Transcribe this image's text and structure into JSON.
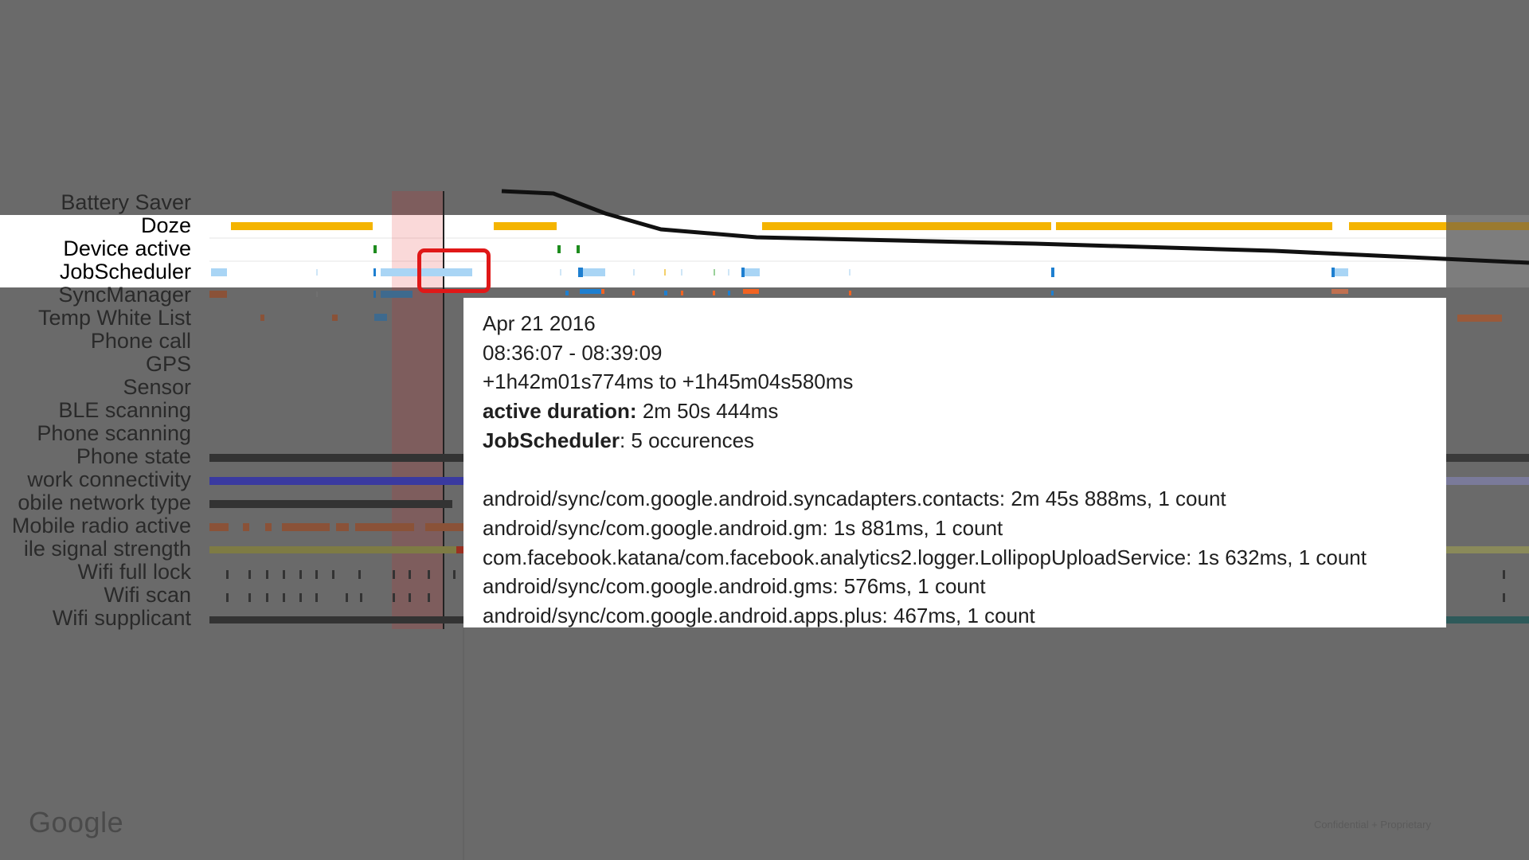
{
  "rows": [
    {
      "label": "Battery Saver",
      "highlighted": false
    },
    {
      "label": "Doze",
      "highlighted": true
    },
    {
      "label": "Device active",
      "highlighted": true
    },
    {
      "label": "JobScheduler",
      "highlighted": true
    },
    {
      "label": "SyncManager",
      "highlighted": false
    },
    {
      "label": "Temp White List",
      "highlighted": false
    },
    {
      "label": "Phone call",
      "highlighted": false
    },
    {
      "label": "GPS",
      "highlighted": false
    },
    {
      "label": "Sensor",
      "highlighted": false
    },
    {
      "label": "BLE scanning",
      "highlighted": false
    },
    {
      "label": "Phone scanning",
      "highlighted": false
    },
    {
      "label": "Phone state",
      "highlighted": false
    },
    {
      "label": "work connectivity",
      "highlighted": false
    },
    {
      "label": "obile network type",
      "highlighted": false
    },
    {
      "label": "Mobile radio active",
      "highlighted": false
    },
    {
      "label": "ile signal strength",
      "highlighted": false
    },
    {
      "label": "Wifi full lock",
      "highlighted": false
    },
    {
      "label": "Wifi scan",
      "highlighted": false
    },
    {
      "label": "Wifi supplicant",
      "highlighted": false
    }
  ],
  "tooltip": {
    "date": "Apr 21 2016",
    "time_range": "08:36:07 - 08:39:09",
    "offset_range": "+1h42m01s774ms to +1h45m04s580ms",
    "active_duration_label": "active duration:",
    "active_duration_value": " 2m 50s 444ms",
    "job_label": "JobScheduler",
    "job_value": ": 5 occurences",
    "entries": [
      "android/sync/com.google.android.syncadapters.contacts: 2m 45s 888ms, 1 count",
      "android/sync/com.google.android.gm: 1s 881ms, 1 count",
      "com.facebook.katana/com.facebook.analytics2.logger.LollipopUploadService: 1s 632ms, 1 count",
      "android/sync/com.google.android.gms: 576ms, 1 count",
      "android/sync/com.google.android.apps.plus: 467ms, 1 count"
    ]
  },
  "footer": {
    "logo": "Google",
    "confidential": "Confidential + Proprietary"
  },
  "colors": {
    "background": "#6a6a6a",
    "doze": "#f4b400",
    "jobscheduler": "#a9d5f5",
    "device_active": "#1e8c1e",
    "sync": "#f26322",
    "phone_state": "#333333",
    "network": "#3a3aa0",
    "highlight": "#e01818"
  }
}
